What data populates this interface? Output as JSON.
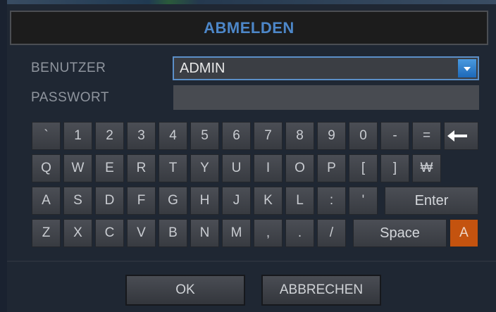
{
  "dialog": {
    "title": "ABMELDEN"
  },
  "form": {
    "user_label": "BENUTZER",
    "user_value": "ADMIN",
    "password_label": "PASSWORT",
    "password_value": ""
  },
  "keyboard": {
    "row1": [
      "`",
      "1",
      "2",
      "3",
      "4",
      "5",
      "6",
      "7",
      "8",
      "9",
      "0",
      "-",
      "="
    ],
    "backspace_icon": "left-arrow-icon",
    "row2": [
      "Q",
      "W",
      "E",
      "R",
      "T",
      "Y",
      "U",
      "I",
      "O",
      "P",
      "[",
      "]",
      "₩"
    ],
    "row3": [
      "A",
      "S",
      "D",
      "F",
      "G",
      "H",
      "J",
      "K",
      "L",
      ":",
      "'"
    ],
    "enter_label": "Enter",
    "row4": [
      "Z",
      "X",
      "C",
      "V",
      "B",
      "N",
      "M",
      ",",
      ".",
      "/"
    ],
    "space_label": "Space",
    "case_toggle_label": "A"
  },
  "buttons": {
    "ok_label": "OK",
    "cancel_label": "ABBRECHEN"
  },
  "colors": {
    "title": "#4d87c9",
    "accent": "#c4530f",
    "dropdown": "#2a7fd0"
  }
}
